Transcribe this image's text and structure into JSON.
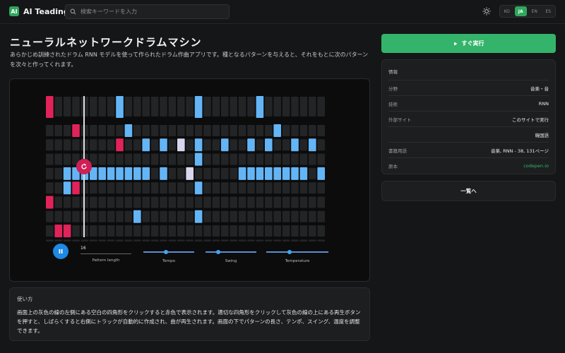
{
  "header": {
    "logo_badge": "AI",
    "logo_text": "AI Teading",
    "search_placeholder": "検索キーワードを入力",
    "languages": [
      "KO",
      "JA",
      "EN",
      "ES"
    ],
    "active_language": "JA"
  },
  "page": {
    "title": "ニューラルネットワークドラムマシン",
    "description": "あらかじめ訓練されたドラム RNN モデルを使って作られたドラム作曲アプリです。種となるパターンを与えると、それをもとに次のパターンを次々と作ってくれます。"
  },
  "drum_machine": {
    "rows": 11,
    "steps": 32,
    "pattern_length": "16",
    "pattern_length_label": "Pattern length",
    "sliders": [
      {
        "label": "Tempo",
        "value": 0.45
      },
      {
        "label": "Swing",
        "value": 0.25
      },
      {
        "label": "Temperature",
        "value": 0.38
      }
    ],
    "colors": {
      "seed": "#e02359",
      "generated": "#64b5f6",
      "highlight": "#dad6ee",
      "empty": "#232425",
      "playhead": "#e0e0e0"
    },
    "seed_cells": [
      [
        0,
        0
      ],
      [
        6,
        0
      ],
      [
        8,
        1
      ],
      [
        8,
        2
      ],
      [
        1,
        3
      ],
      [
        5,
        3
      ],
      [
        2,
        8
      ]
    ],
    "generated_cells": [
      [
        0,
        8
      ],
      [
        0,
        17
      ],
      [
        0,
        24
      ],
      [
        1,
        9
      ],
      [
        1,
        26
      ],
      [
        2,
        8
      ],
      [
        2,
        11
      ],
      [
        2,
        13
      ],
      [
        2,
        15
      ],
      [
        2,
        17
      ],
      [
        2,
        20
      ],
      [
        2,
        23
      ],
      [
        2,
        25
      ],
      [
        2,
        28
      ],
      [
        2,
        30
      ],
      [
        3,
        17
      ],
      [
        4,
        2
      ],
      [
        4,
        3
      ],
      [
        4,
        4
      ],
      [
        4,
        5
      ],
      [
        4,
        6
      ],
      [
        4,
        7
      ],
      [
        4,
        8
      ],
      [
        4,
        9
      ],
      [
        4,
        10
      ],
      [
        4,
        11
      ],
      [
        4,
        13
      ],
      [
        4,
        16
      ],
      [
        4,
        22
      ],
      [
        4,
        23
      ],
      [
        4,
        24
      ],
      [
        4,
        25
      ],
      [
        4,
        26
      ],
      [
        4,
        27
      ],
      [
        4,
        28
      ],
      [
        4,
        29
      ],
      [
        4,
        31
      ],
      [
        5,
        2
      ],
      [
        5,
        17
      ],
      [
        7,
        10
      ],
      [
        7,
        17
      ]
    ],
    "highlight_cells": [
      [
        2,
        15
      ],
      [
        4,
        16
      ]
    ]
  },
  "howto": {
    "heading": "使い方",
    "body": "画面上の灰色の線の左側にある空白の四角形をクリックすると赤色で表示されます。適切な四角形をクリックして灰色の線の上にある再生ボタンを押すと、しばらくすると右側にトラックが自動的に作成され、曲が再生されます。画面の下でパターンの長さ、テンポ、スイング、温度を調整できます。"
  },
  "sidebar": {
    "run_label": "すぐ実行",
    "info_heading": "情報",
    "rows": [
      {
        "key": "分野",
        "value": "音楽・音"
      },
      {
        "key": "技術",
        "value": "RNN"
      },
      {
        "key": "外部サイト",
        "value": "このサイトで実行"
      },
      {
        "key": "",
        "value": "韓国語"
      },
      {
        "key": "書籍用語",
        "value": "音楽, RNN - 38, 131ページ"
      },
      {
        "key": "原本",
        "value": "codepen.io"
      }
    ],
    "list_label": "一覧へ"
  }
}
